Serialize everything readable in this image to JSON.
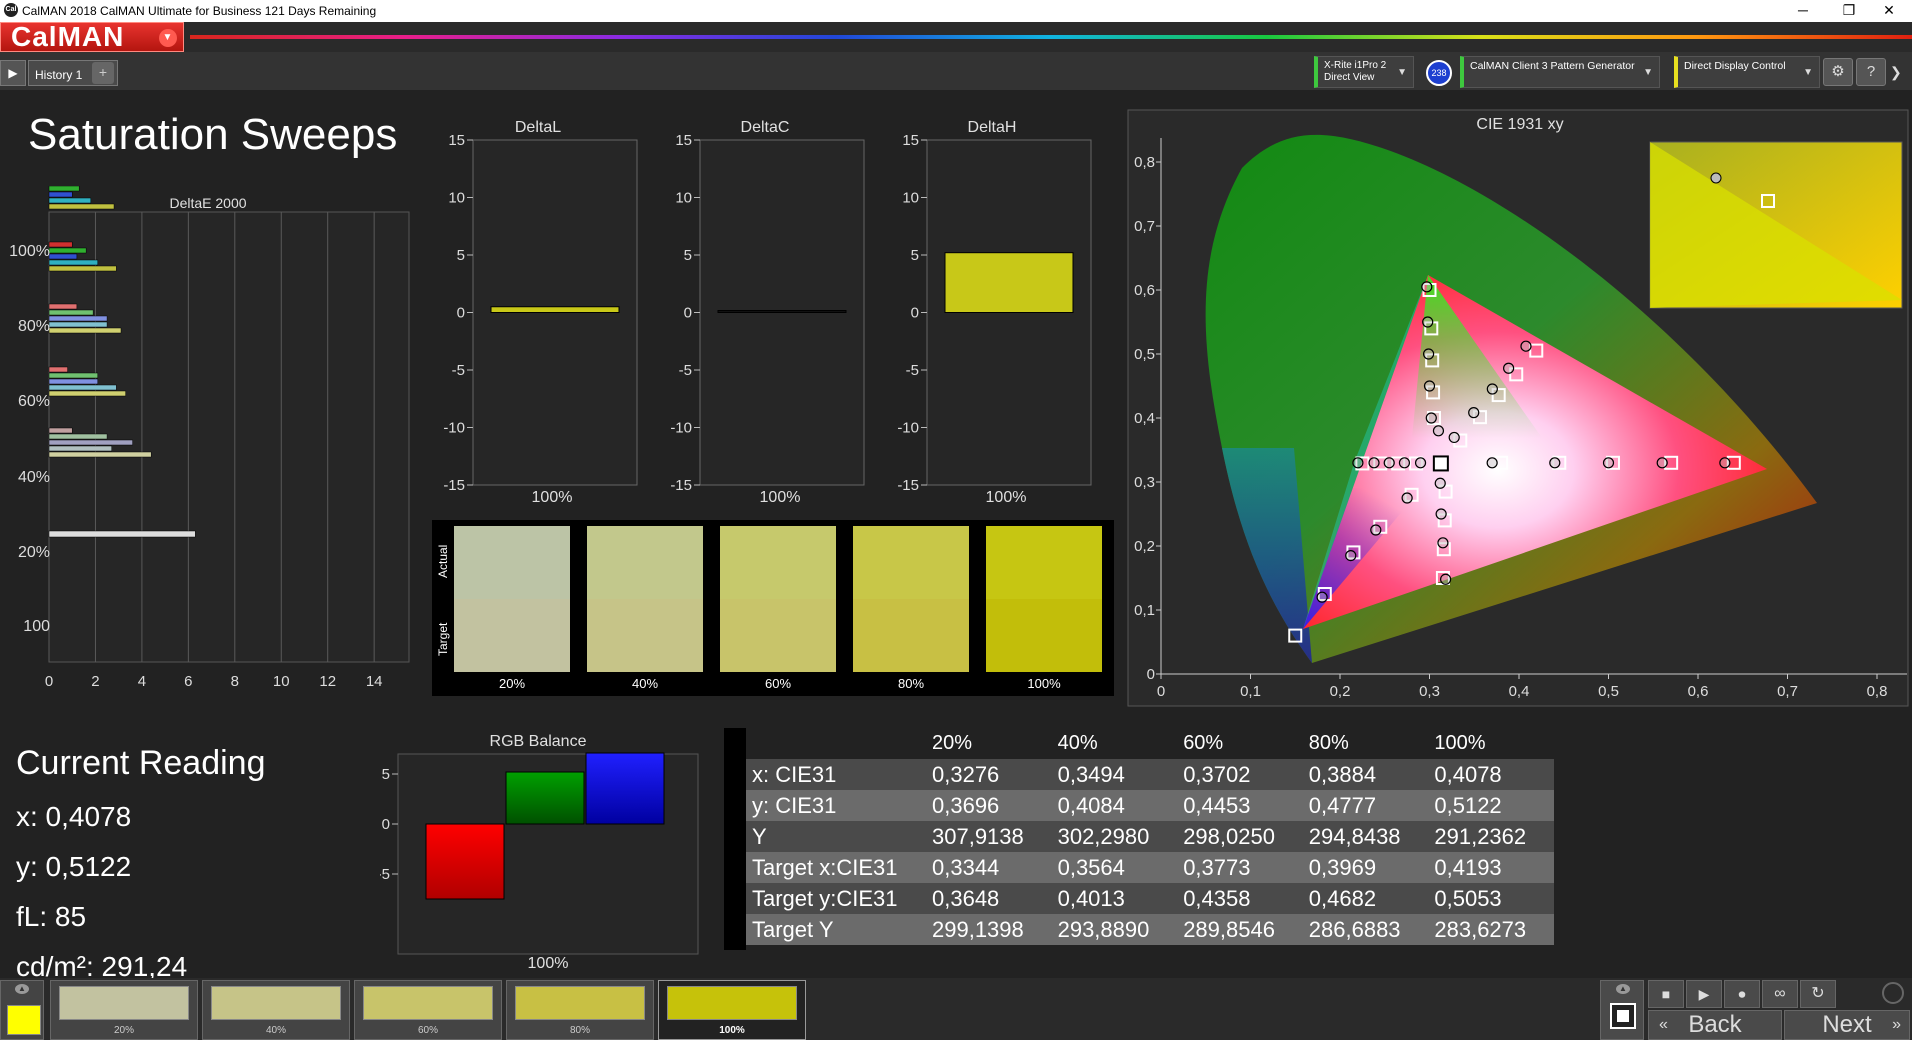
{
  "window": {
    "title": "CalMAN 2018 CalMAN Ultimate for Business 121 Days Remaining",
    "minimize": "─",
    "restore": "❐",
    "close": "✕"
  },
  "brand": {
    "logo": "CalMAN",
    "menu_icon": "chevron-down-icon"
  },
  "history": {
    "tab_label": "History 1"
  },
  "devices": {
    "meter": "X-Rite i1Pro 2\nDirect View",
    "meter_badge": "238",
    "generator": "CalMAN Client 3 Pattern Generator",
    "display": "Direct Display Control"
  },
  "page": {
    "title": "Saturation Sweeps"
  },
  "deltaE_chart": {
    "title": "DeltaE 2000",
    "x_ticks": [
      "0",
      "2",
      "4",
      "6",
      "8",
      "10",
      "12",
      "14"
    ],
    "y_labels": [
      "100%",
      "80%",
      "60%",
      "40%",
      "20%",
      "100"
    ]
  },
  "delta_charts": {
    "y_ticks": [
      "15",
      "10",
      "5",
      "0",
      "-5",
      "-10",
      "-15"
    ],
    "deltaL": {
      "title": "DeltaL",
      "label": "100%",
      "value": 0.5
    },
    "deltaC": {
      "title": "DeltaC",
      "label": "100%",
      "value": 0.05
    },
    "deltaH": {
      "title": "DeltaH",
      "label": "100%",
      "value": 5.2
    }
  },
  "swatches": {
    "actual_label": "Actual",
    "target_label": "Target",
    "items": [
      {
        "label": "20%",
        "actual": "#bcc4a6",
        "target": "#c2c2a0"
      },
      {
        "label": "40%",
        "actual": "#c2c88c",
        "target": "#c6c488"
      },
      {
        "label": "60%",
        "actual": "#c6c96c",
        "target": "#c8c46a"
      },
      {
        "label": "80%",
        "actual": "#c8c748",
        "target": "#c8c044"
      },
      {
        "label": "100%",
        "actual": "#c6c612",
        "target": "#c2be0a"
      }
    ]
  },
  "cie": {
    "title": "CIE 1931 xy",
    "x_ticks": [
      "0",
      "0,1",
      "0,2",
      "0,3",
      "0,4",
      "0,5",
      "0,6",
      "0,7",
      "0,8"
    ],
    "y_ticks": [
      "0",
      "0,1",
      "0,2",
      "0,3",
      "0,4",
      "0,5",
      "0,6",
      "0,7",
      "0,8"
    ]
  },
  "current_reading": {
    "title": "Current Reading",
    "x": "x: 0,4078",
    "y": "y: 0,5122",
    "fl": "fL: 85",
    "cd": "cd/m²: 291,24"
  },
  "rgb_balance": {
    "title": "RGB Balance",
    "label": "100%",
    "y_ticks": [
      "5",
      "0",
      "-5"
    ],
    "red": -7.5,
    "green": 5.2,
    "blue": 7.1
  },
  "table": {
    "columns": [
      "",
      "20%",
      "40%",
      "60%",
      "80%",
      "100%"
    ],
    "rows": [
      {
        "name": "x: CIE31",
        "values": [
          "0,3276",
          "0,3494",
          "0,3702",
          "0,3884",
          "0,4078"
        ]
      },
      {
        "name": "y: CIE31",
        "values": [
          "0,3696",
          "0,4084",
          "0,4453",
          "0,4777",
          "0,5122"
        ]
      },
      {
        "name": "Y",
        "values": [
          "307,9138",
          "302,2980",
          "298,0250",
          "294,8438",
          "291,2362"
        ]
      },
      {
        "name": "Target x:CIE31",
        "values": [
          "0,3344",
          "0,3564",
          "0,3773",
          "0,3969",
          "0,4193"
        ]
      },
      {
        "name": "Target y:CIE31",
        "values": [
          "0,3648",
          "0,4013",
          "0,4358",
          "0,4682",
          "0,5053"
        ]
      },
      {
        "name": "Target Y",
        "values": [
          "299,1398",
          "293,8890",
          "289,8546",
          "286,6883",
          "283,6273"
        ]
      }
    ]
  },
  "patches": [
    {
      "label": "20%",
      "color": "#c2c2a0"
    },
    {
      "label": "40%",
      "color": "#c6c488"
    },
    {
      "label": "60%",
      "color": "#c8c46a"
    },
    {
      "label": "80%",
      "color": "#c8c044"
    },
    {
      "label": "100%",
      "color": "#c6c20a"
    }
  ],
  "nav": {
    "back": "Back",
    "next": "Next"
  }
}
